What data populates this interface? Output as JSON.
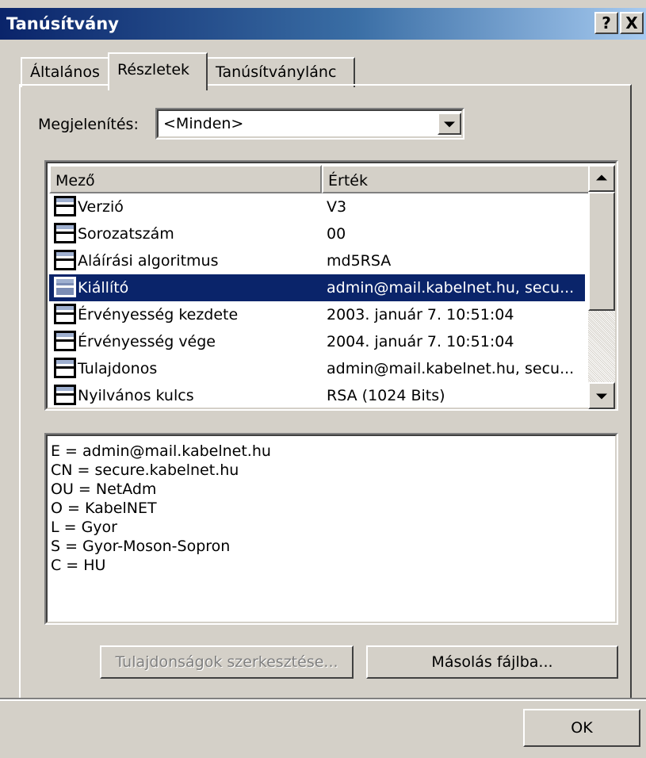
{
  "window": {
    "title": "Tanúsítvány",
    "help_label": "?",
    "close_label": "X"
  },
  "tabs": [
    {
      "label": "Általános"
    },
    {
      "label": "Részletek"
    },
    {
      "label": "Tanúsítványlánc"
    }
  ],
  "show": {
    "label": "Megjelenítés:",
    "value": "<Minden>"
  },
  "list": {
    "columns": [
      "Mező",
      "Érték"
    ],
    "rows": [
      {
        "field": "Verzió",
        "value": "V3"
      },
      {
        "field": "Sorozatszám",
        "value": "00"
      },
      {
        "field": "Aláírási algoritmus",
        "value": "md5RSA"
      },
      {
        "field": "Kiállító",
        "value": "admin@mail.kabelnet.hu, secu..."
      },
      {
        "field": "Érvényesség kezdete",
        "value": "2003. január 7. 10:51:04"
      },
      {
        "field": "Érvényesség vége",
        "value": "2004. január 7. 10:51:04"
      },
      {
        "field": "Tulajdonos",
        "value": "admin@mail.kabelnet.hu, secu..."
      },
      {
        "field": "Nyilvános kulcs",
        "value": "RSA (1024 Bits)"
      }
    ],
    "selected_index": 3
  },
  "details": [
    "E = admin@mail.kabelnet.hu",
    "CN = secure.kabelnet.hu",
    "OU = NetAdm",
    "O = KabelNET",
    "L = Gyor",
    "S = Gyor-Moson-Sopron",
    "C = HU"
  ],
  "buttons": {
    "edit_properties": "Tulajdonságok szerkesztése...",
    "copy_to_file": "Másolás fájlba...",
    "ok": "OK"
  }
}
